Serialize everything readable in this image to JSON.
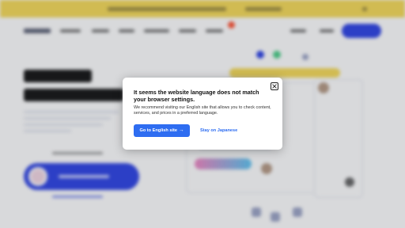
{
  "modal": {
    "title": "It seems the website language does not match your browser settings.",
    "description": "We recommend visiting our English site that allows you to check content, services, and prices in a preferred language.",
    "primary_button": "Go to English site",
    "primary_button_icon": "arrow-right-icon",
    "secondary_button": "Stay on Japanese",
    "close_icon": "close-icon"
  },
  "colors": {
    "primary": "#2e6df1",
    "promo_banner": "#f7dc5c",
    "nav_cta": "#3348e6"
  }
}
